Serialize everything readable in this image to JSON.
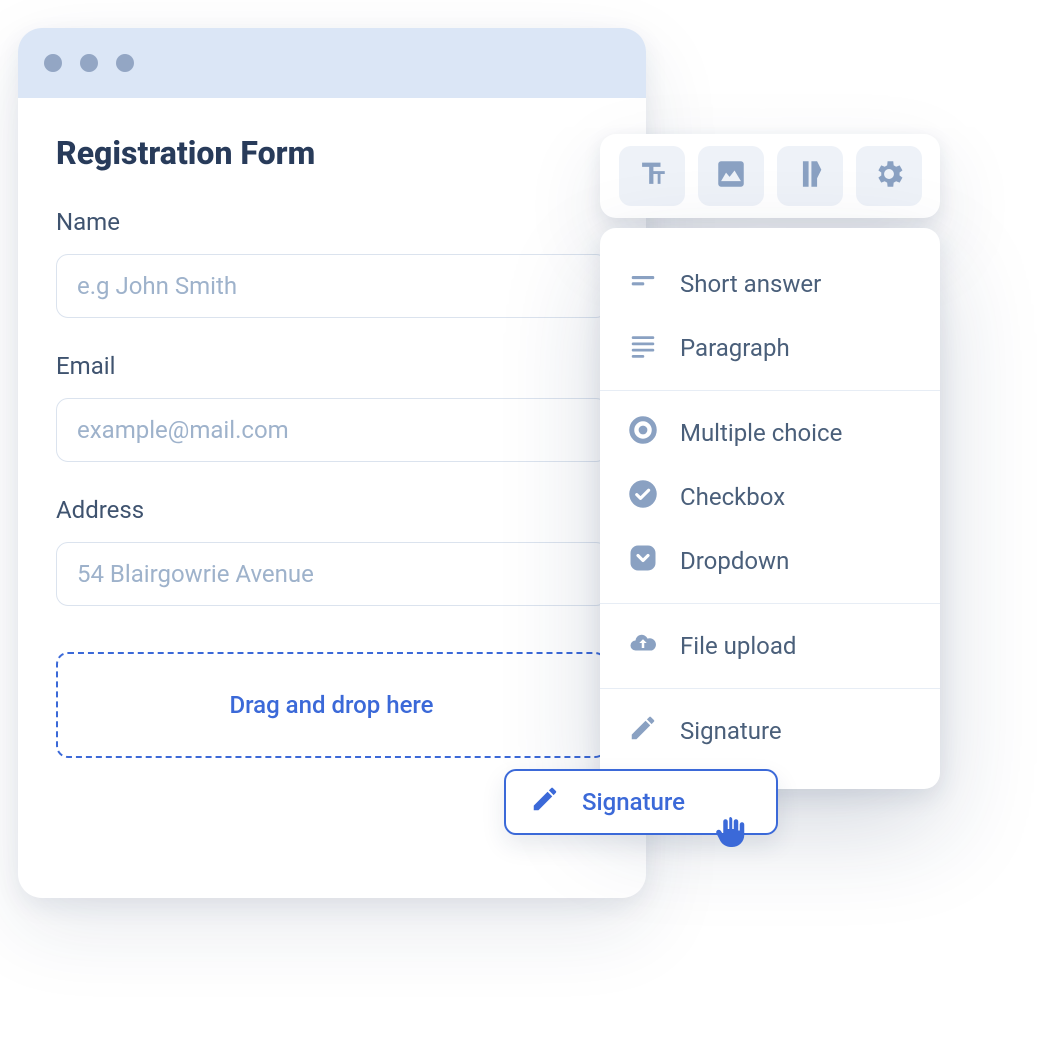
{
  "form": {
    "title": "Registration Form",
    "fields": [
      {
        "label": "Name",
        "placeholder": "e.g John Smith"
      },
      {
        "label": "Email",
        "placeholder": "example@mail.com"
      },
      {
        "label": "Address",
        "placeholder": "54 Blairgowrie Avenue"
      }
    ],
    "dropzone": "Drag and drop here"
  },
  "toolbar": {
    "buttons": [
      "text",
      "image",
      "theme",
      "settings"
    ]
  },
  "panel": {
    "groups": [
      [
        {
          "icon": "short-answer",
          "label": "Short answer"
        },
        {
          "icon": "paragraph",
          "label": "Paragraph"
        }
      ],
      [
        {
          "icon": "radio",
          "label": "Multiple choice"
        },
        {
          "icon": "check",
          "label": "Checkbox"
        },
        {
          "icon": "dropdown",
          "label": "Dropdown"
        }
      ],
      [
        {
          "icon": "upload",
          "label": "File upload"
        }
      ],
      [
        {
          "icon": "signature",
          "label": "Signature"
        }
      ]
    ]
  },
  "drag_chip": {
    "label": "Signature"
  }
}
